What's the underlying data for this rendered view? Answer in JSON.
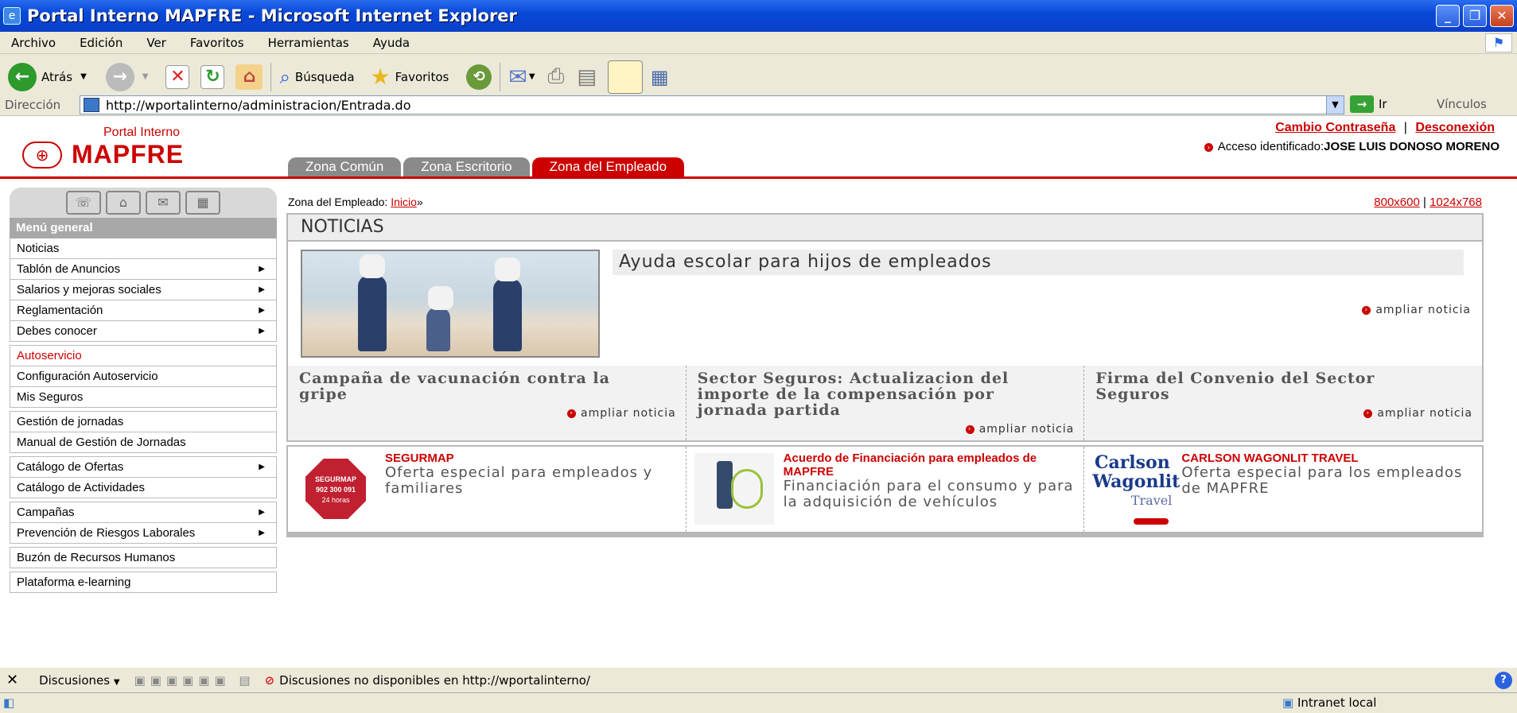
{
  "window": {
    "title": "Portal Interno MAPFRE - Microsoft Internet Explorer"
  },
  "menubar": [
    "Archivo",
    "Edición",
    "Ver",
    "Favoritos",
    "Herramientas",
    "Ayuda"
  ],
  "toolbar": {
    "back": "Atrás",
    "search": "Búsqueda",
    "favorites": "Favoritos"
  },
  "address": {
    "label": "Dirección",
    "url": "http://wportalinterno/administracion/Entrada.do",
    "go": "Ir",
    "links": "Vínculos"
  },
  "portal": {
    "logo_sub": "Portal Interno",
    "logo_name": "MAPFRE",
    "change_password": "Cambio Contraseña",
    "separator": "|",
    "logout": "Desconexión",
    "access_label": "Acceso identificado:",
    "user": "JOSE LUIS DONOSO MORENO",
    "tabs": [
      "Zona Común",
      "Zona Escritorio",
      "Zona del Empleado"
    ]
  },
  "breadcrumb": {
    "prefix": "Zona del Empleado:",
    "link": "Inicio",
    "suffix": "»"
  },
  "resolution": {
    "r1": "800x600",
    "sep": "|",
    "r2": "1024x768"
  },
  "sidebar": {
    "title": "Menú general",
    "items": [
      "Noticias",
      "Tablón de Anuncios",
      "Salarios y mejoras sociales",
      "Reglamentación",
      "Debes conocer",
      "Autoservicio",
      "Configuración Autoservicio",
      "Mis Seguros",
      "Gestión de jornadas",
      "Manual de Gestión de Jornadas",
      "Catálogo de Ofertas",
      "Catálogo de Actividades",
      "Campañas",
      "Prevención de Riesgos Laborales",
      "Buzón de Recursos Humanos",
      "Plataforma e-learning"
    ]
  },
  "news": {
    "header": "NOTICIAS",
    "feature_title": "Ayuda escolar para hijos de empleados",
    "more": "ampliar noticia",
    "items": [
      "Campaña de vacunación contra la gripe",
      "Sector Seguros: Actualizacion del importe de la compensación por jornada partida",
      "Firma del Convenio del Sector Seguros"
    ]
  },
  "offers": [
    {
      "title": "SEGURMAP",
      "desc": "Oferta especial para empleados y familiares",
      "logo": "SEGURMAP",
      "phone": "902 300 091",
      "hours": "24 horas"
    },
    {
      "title": "Acuerdo de Financiación para empleados de MAPFRE",
      "desc": "Financiación para el consumo y para la adquisición de vehículos"
    },
    {
      "title": "CARLSON WAGONLIT TRAVEL",
      "desc": "Oferta especial para los empleados de MAPFRE",
      "logo1": "Carlson",
      "logo2": "Wagonlit",
      "logo3": "Travel"
    }
  ],
  "discussions": {
    "label": "Discusiones",
    "status": "Discusiones no disponibles en http://wportalinterno/"
  },
  "status": {
    "zone": "Intranet local"
  }
}
